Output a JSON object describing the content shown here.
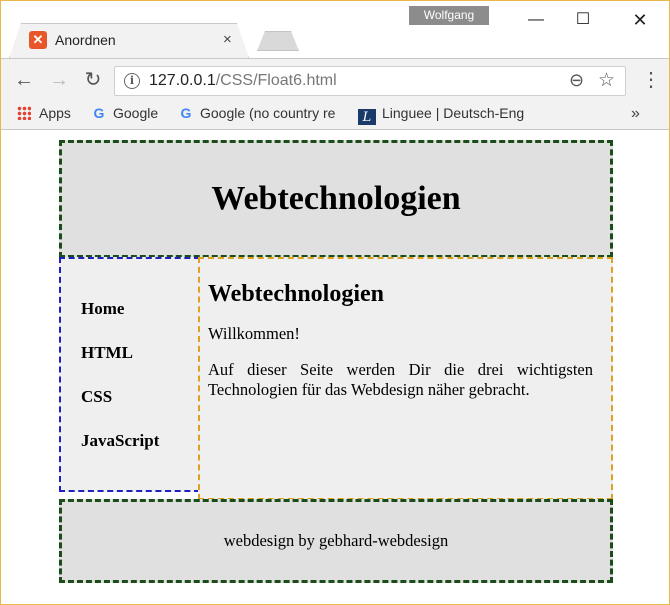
{
  "window": {
    "profile_name": "Wolfgang",
    "minimize": "—",
    "maximize": "☐",
    "close": "✕"
  },
  "tab": {
    "title": "Anordnen",
    "close": "×",
    "favicon": "xampp-icon"
  },
  "toolbar": {
    "back": "←",
    "forward": "→",
    "reload": "↻",
    "url_host": "127.0.0.1",
    "url_path": "/CSS/Float6.html",
    "zoom_icon": "⊖",
    "star_icon": "☆",
    "menu_icon": "⋮"
  },
  "bookmarks": {
    "apps": "Apps",
    "google1": "Google",
    "google2": "Google (no country re",
    "linguee": "Linguee | Deutsch-Eng",
    "more": "»"
  },
  "site": {
    "header_title": "Webtechnologien",
    "nav": [
      "Home",
      "HTML",
      "CSS",
      "JavaScript"
    ],
    "main_heading": "Webtechnologien",
    "welcome": "Willkommen!",
    "paragraph": "Auf dieser Seite werden Dir die drei wichtigsten Technologien für das Webdesign näher gebracht.",
    "footer": "webdesign by gebhard-webdesign"
  },
  "colors": {
    "header_border": "#1a4d1a",
    "nav_border": "#2020c0",
    "main_border": "#e0a020",
    "window_border": "#e8b84a"
  }
}
